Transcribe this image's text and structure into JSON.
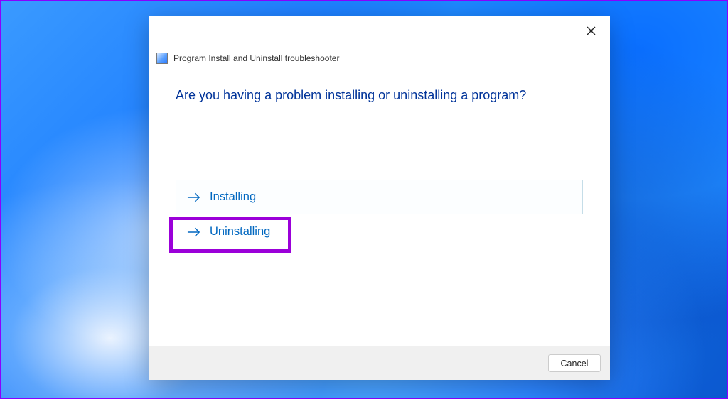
{
  "window": {
    "title": "Program Install and Uninstall troubleshooter"
  },
  "question": "Are you having a problem installing or uninstalling a program?",
  "options": [
    {
      "label": "Installing"
    },
    {
      "label": "Uninstalling"
    }
  ],
  "buttons": {
    "cancel": "Cancel"
  }
}
